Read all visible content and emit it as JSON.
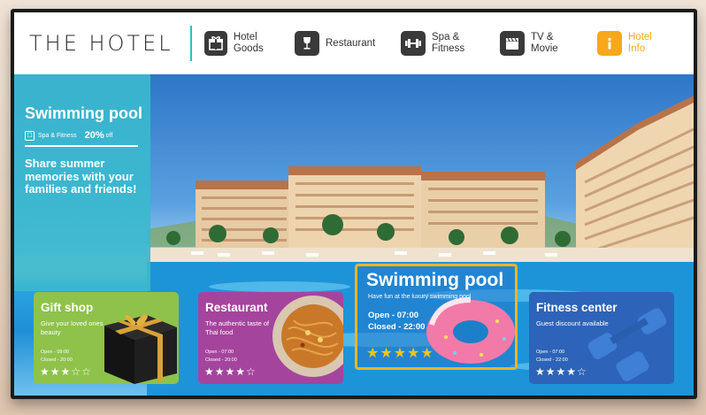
{
  "brand": {
    "name": "THE HOTEL"
  },
  "nav": [
    {
      "label": "Hotel\nGoods",
      "icon": "gift-icon"
    },
    {
      "label": "Restaurant",
      "icon": "wine-glass-icon"
    },
    {
      "label": "Spa &\nFitness",
      "icon": "dumbbell-icon"
    },
    {
      "label": "TV &\nMovie",
      "icon": "clapperboard-icon"
    },
    {
      "label": "Hotel\nInfo",
      "icon": "info-icon",
      "active": true
    }
  ],
  "promo": {
    "title": "Swimming pool",
    "tag_label": "Spa & Fitness",
    "discount": "20%",
    "discount_suffix": "off",
    "description": "Share summer memories with your families and friends!"
  },
  "cards": {
    "gift": {
      "title": "Gift shop",
      "desc": "Give your loved ones beauty",
      "open": "Open - 09:00",
      "closed": "Closed - 20:00",
      "stars": "★★★☆☆"
    },
    "restaurant": {
      "title": "Restaurant",
      "desc": "The authentic taste of Thai food",
      "open": "Open - 07:00",
      "closed": "Closed - 20:00",
      "stars": "★★★★☆"
    },
    "featured": {
      "title": "Swimming pool",
      "desc": "Have fun at the luxury swimming pool",
      "open": "Open - 07:00",
      "closed": "Closed - 22:00",
      "stars": "★★★★★"
    },
    "fitness": {
      "title": "Fitness center",
      "desc": "Guest discount available",
      "open": "Open - 07:00",
      "closed": "Closed - 22:00",
      "stars": "★★★★☆"
    }
  },
  "colors": {
    "accent": "#27c2c9",
    "active": "#f7a81b",
    "promo": "#3bb8ce",
    "gift": "#8fc24a",
    "restaurant": "#a5449d",
    "fitness": "#2d63b8",
    "featured_border": "#f2b41c"
  }
}
